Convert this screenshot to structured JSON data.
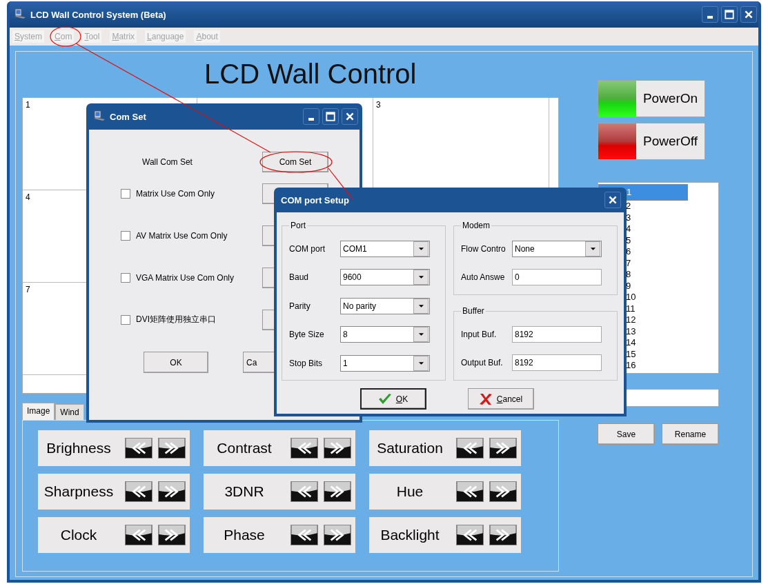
{
  "window": {
    "title": "LCD Wall Control System (Beta)"
  },
  "menu": [
    {
      "label": "System"
    },
    {
      "label": "Com"
    },
    {
      "label": "Tool"
    },
    {
      "label": "Matrix"
    },
    {
      "label": "Language"
    },
    {
      "label": "About"
    }
  ],
  "heading": "LCD Wall Control",
  "wall_cells": [
    {
      "label": "1"
    },
    {},
    {
      "label": "3"
    },
    {
      "label": "4"
    },
    {},
    {},
    {
      "label": "7"
    },
    {},
    {}
  ],
  "power_buttons": [
    {
      "label": "PowerOn",
      "kind": "on"
    },
    {
      "label": "PowerOff",
      "kind": "off"
    }
  ],
  "wall_list": [
    {
      "label": "1",
      "selected": true
    },
    {
      "label": "2",
      "selected": false
    },
    {
      "label": "3",
      "selected": false
    },
    {
      "label": "4",
      "selected": false
    },
    {
      "label": "5",
      "selected": false
    },
    {
      "label": "6",
      "selected": false
    },
    {
      "label": "7",
      "selected": false
    },
    {
      "label": "8",
      "selected": false
    },
    {
      "label": "9",
      "selected": false
    },
    {
      "label": "10",
      "selected": false
    },
    {
      "label": "11",
      "selected": false
    },
    {
      "label": "12",
      "selected": false
    },
    {
      "label": "13",
      "selected": false
    },
    {
      "label": "14",
      "selected": false
    },
    {
      "label": "15",
      "selected": false
    },
    {
      "label": "16",
      "selected": false
    }
  ],
  "list_buttons": [
    "Save",
    "Rename"
  ],
  "tabs": [
    {
      "label": "Image",
      "selected": true
    },
    {
      "label": "Wind",
      "selected": false
    }
  ],
  "adjustments": [
    {
      "label": "Brighness"
    },
    {
      "label": "Contrast"
    },
    {
      "label": "Saturation"
    },
    {
      "label": "Sharpness"
    },
    {
      "label": "3DNR"
    },
    {
      "label": "Hue"
    },
    {
      "label": "Clock"
    },
    {
      "label": "Phase"
    },
    {
      "label": "Backlight"
    }
  ],
  "com_set_dialog": {
    "title": "Com Set",
    "wall_com_label": "Wall Com Set",
    "com_set_button": "Com Set",
    "options": [
      {
        "label": "Matrix Use Com Only",
        "checked": false
      },
      {
        "label": "AV Matrix Use Com Only",
        "checked": false
      },
      {
        "label": "VGA Matrix Use Com Only",
        "checked": false
      },
      {
        "label": "DVI矩阵使用独立串口",
        "checked": false
      }
    ],
    "buttons": [
      "OK",
      "Ca"
    ]
  },
  "com_port_dialog": {
    "title": "COM port Setup",
    "port_group": {
      "title": "Port",
      "fields": [
        {
          "label": "COM port",
          "value": "COM1",
          "kind": "select"
        },
        {
          "label": "Baud",
          "value": "9600",
          "kind": "select"
        },
        {
          "label": "Parity",
          "value": "No parity",
          "kind": "select"
        },
        {
          "label": "Byte Size",
          "value": "8",
          "kind": "select"
        },
        {
          "label": "Stop Bits",
          "value": "1",
          "kind": "select"
        }
      ]
    },
    "modem_group": {
      "title": "Modem",
      "fields": [
        {
          "label": "Flow Contro",
          "value": "None",
          "kind": "select"
        },
        {
          "label": "Auto Answe",
          "value": "0",
          "kind": "input"
        }
      ]
    },
    "buffer_group": {
      "title": "Buffer",
      "fields": [
        {
          "label": "Input Buf.",
          "value": "8192",
          "kind": "input"
        },
        {
          "label": "Output Buf.",
          "value": "8192",
          "kind": "input"
        }
      ]
    },
    "buttons": [
      {
        "label": "OK",
        "kind": "ok"
      },
      {
        "label": "Cancel",
        "kind": "cancel"
      }
    ]
  }
}
